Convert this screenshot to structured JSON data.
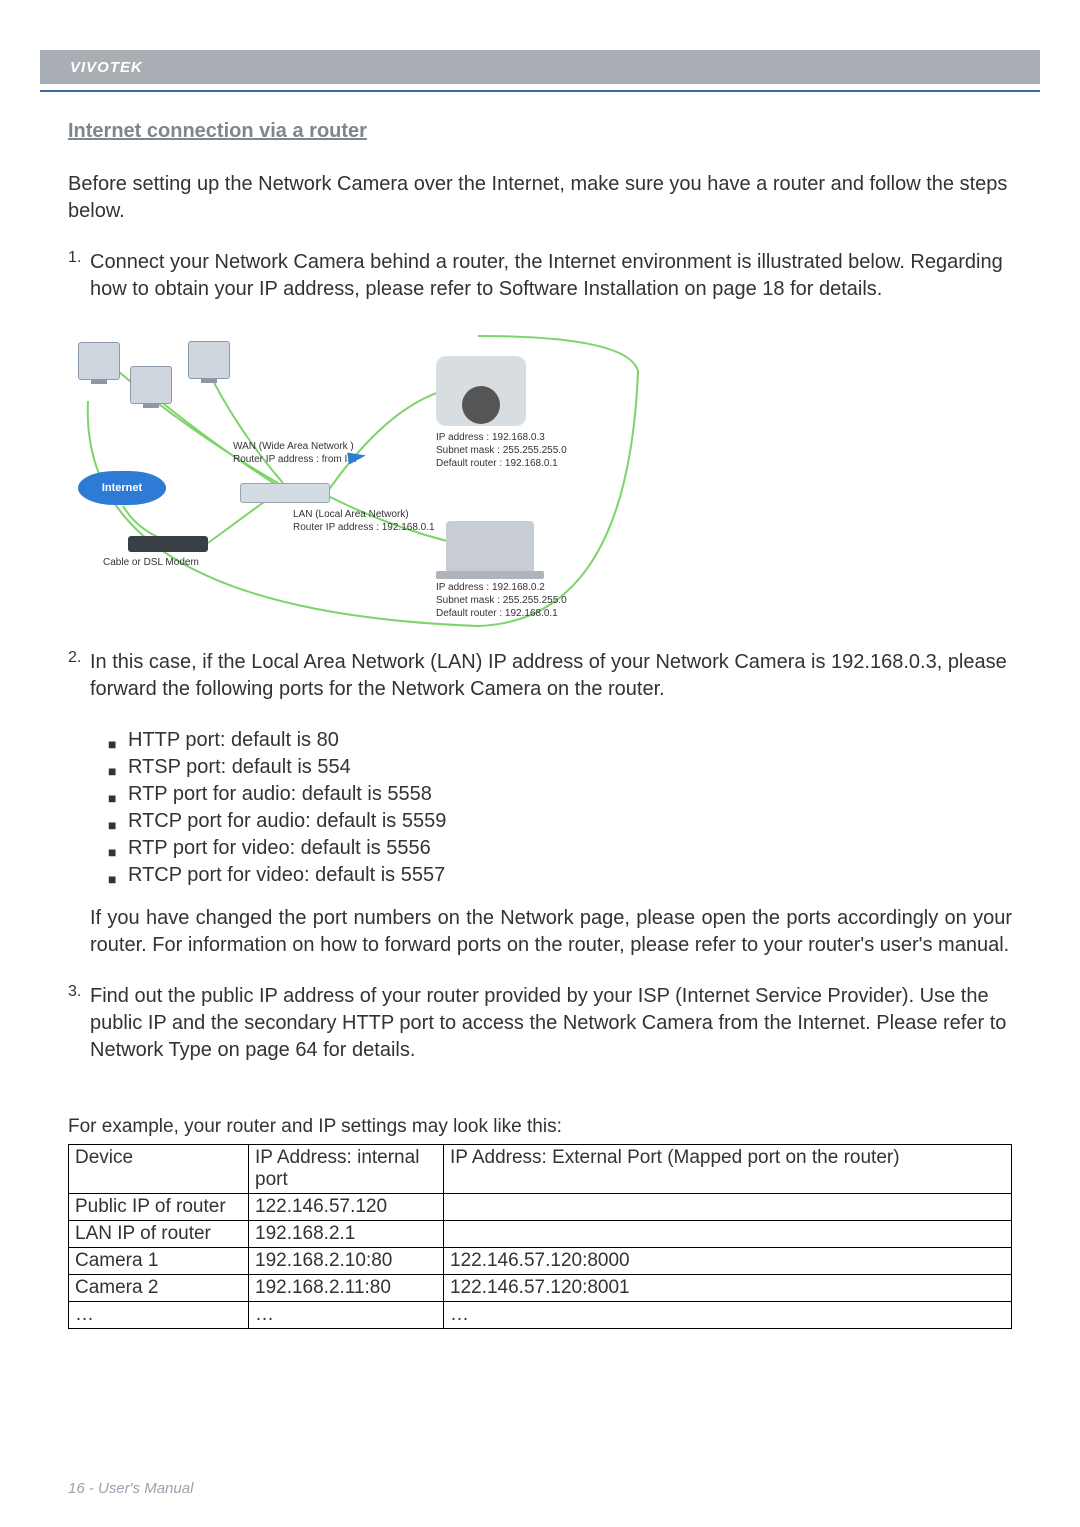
{
  "brand": "VIVOTEK",
  "section_title": "Internet connection via a router",
  "intro": "Before setting up the Network Camera over the Internet, make sure you have a router and follow the steps below.",
  "step1": {
    "num": "1.",
    "text": "Connect your Network Camera behind a router, the Internet environment is illustrated below. Regarding how to obtain your IP address, please refer to Software Installation on page 18 for details."
  },
  "diagram": {
    "internet": "Internet",
    "wan": "WAN (Wide Area Network )\nRouter IP address : from ISP",
    "lan": "LAN (Local Area Network)\nRouter IP address : 192.168.0.1",
    "modem": "Cable or DSL Modem",
    "cam": "IP address : 192.168.0.3\nSubnet mask : 255.255.255.0\nDefault router : 192.168.0.1",
    "laptop": "IP address : 192.168.0.2\nSubnet mask : 255.255.255.0\nDefault router : 192.168.0.1"
  },
  "step2": {
    "num": "2.",
    "text": "In this case, if the Local Area Network (LAN) IP address of your Network Camera is 192.168.0.3, please forward the following ports for the Network Camera on the router.",
    "ports": [
      "HTTP port: default is 80",
      "RTSP port: default is 554",
      "RTP port for audio: default is 5558",
      "RTCP port for audio: default is 5559",
      "RTP port for video: default is 5556",
      "RTCP port for video: default is 5557"
    ],
    "note": "If you have changed the port numbers on the Network page, please open the ports accordingly on your router. For information on how to forward ports on the router, please refer to your router's user's manual."
  },
  "step3": {
    "num": "3.",
    "text": "Find out the public IP address of your router provided by your ISP (Internet Service Provider). Use the public IP and the secondary HTTP port to access the Network Camera from the Internet. Please refer to Network Type on page 64 for details."
  },
  "for_example": "For example, your router and IP settings may look like this:",
  "table": {
    "headers": [
      "Device",
      "IP Address: internal port",
      "IP Address: External Port (Mapped port on the router)"
    ],
    "rows": [
      [
        "Public IP of router",
        "122.146.57.120",
        ""
      ],
      [
        "LAN IP of router",
        "192.168.2.1",
        ""
      ],
      [
        "Camera 1",
        "192.168.2.10:80",
        "122.146.57.120:8000"
      ],
      [
        "Camera 2",
        "192.168.2.11:80",
        "122.146.57.120:8001"
      ],
      [
        "…",
        "…",
        "…"
      ]
    ]
  },
  "footer": "16 - User's Manual"
}
